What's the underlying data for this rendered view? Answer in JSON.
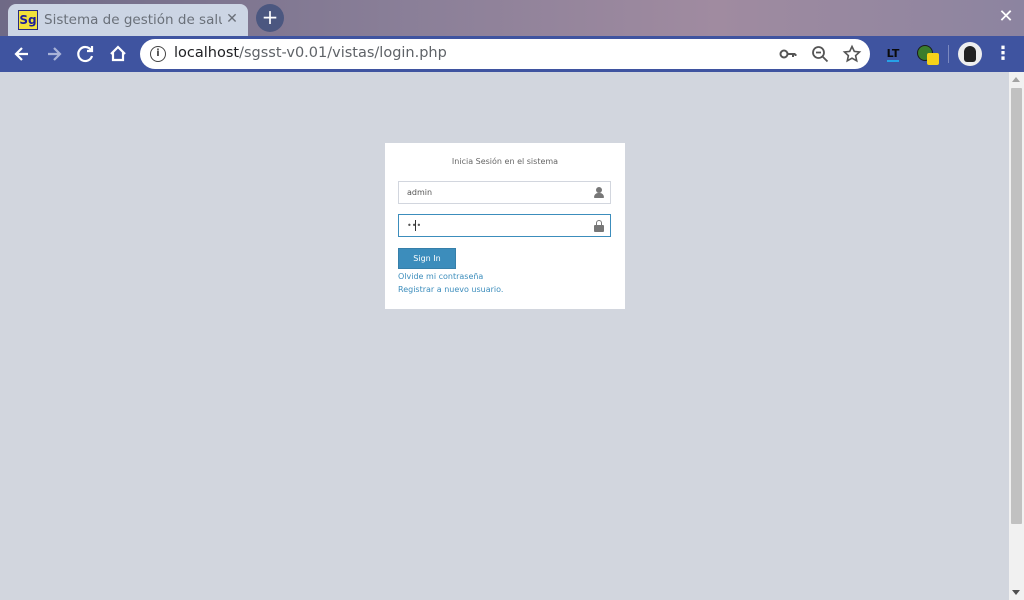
{
  "browser": {
    "tab": {
      "favicon_text": "Sg",
      "title": "Sistema de gestión de salud"
    },
    "new_tab_symbol": "+",
    "close_symbol": "✕",
    "url": {
      "host": "localhost",
      "path": "/sgsst-v0.01/vistas/login.php"
    },
    "extensions": {
      "lt_label": "LT"
    },
    "icons": [
      "back-icon",
      "forward-icon",
      "reload-icon",
      "home-icon",
      "info-icon",
      "key-icon",
      "zoom-out-icon",
      "star-icon",
      "languagetool-extension-icon",
      "globe-extension-icon",
      "profile-avatar-icon",
      "menu-icon"
    ]
  },
  "login": {
    "message": "Inicia Sesión en el sistema",
    "username_value": "admin",
    "password_value": "•••",
    "signin_label": "Sign In",
    "forgot_label": "Olvide mi contraseña",
    "register_label": "Registrar a nuevo usuario."
  },
  "colors": {
    "page_background": "#d2d6de",
    "accent": "#3c8dbc",
    "toolbar": "#3f54a0"
  }
}
